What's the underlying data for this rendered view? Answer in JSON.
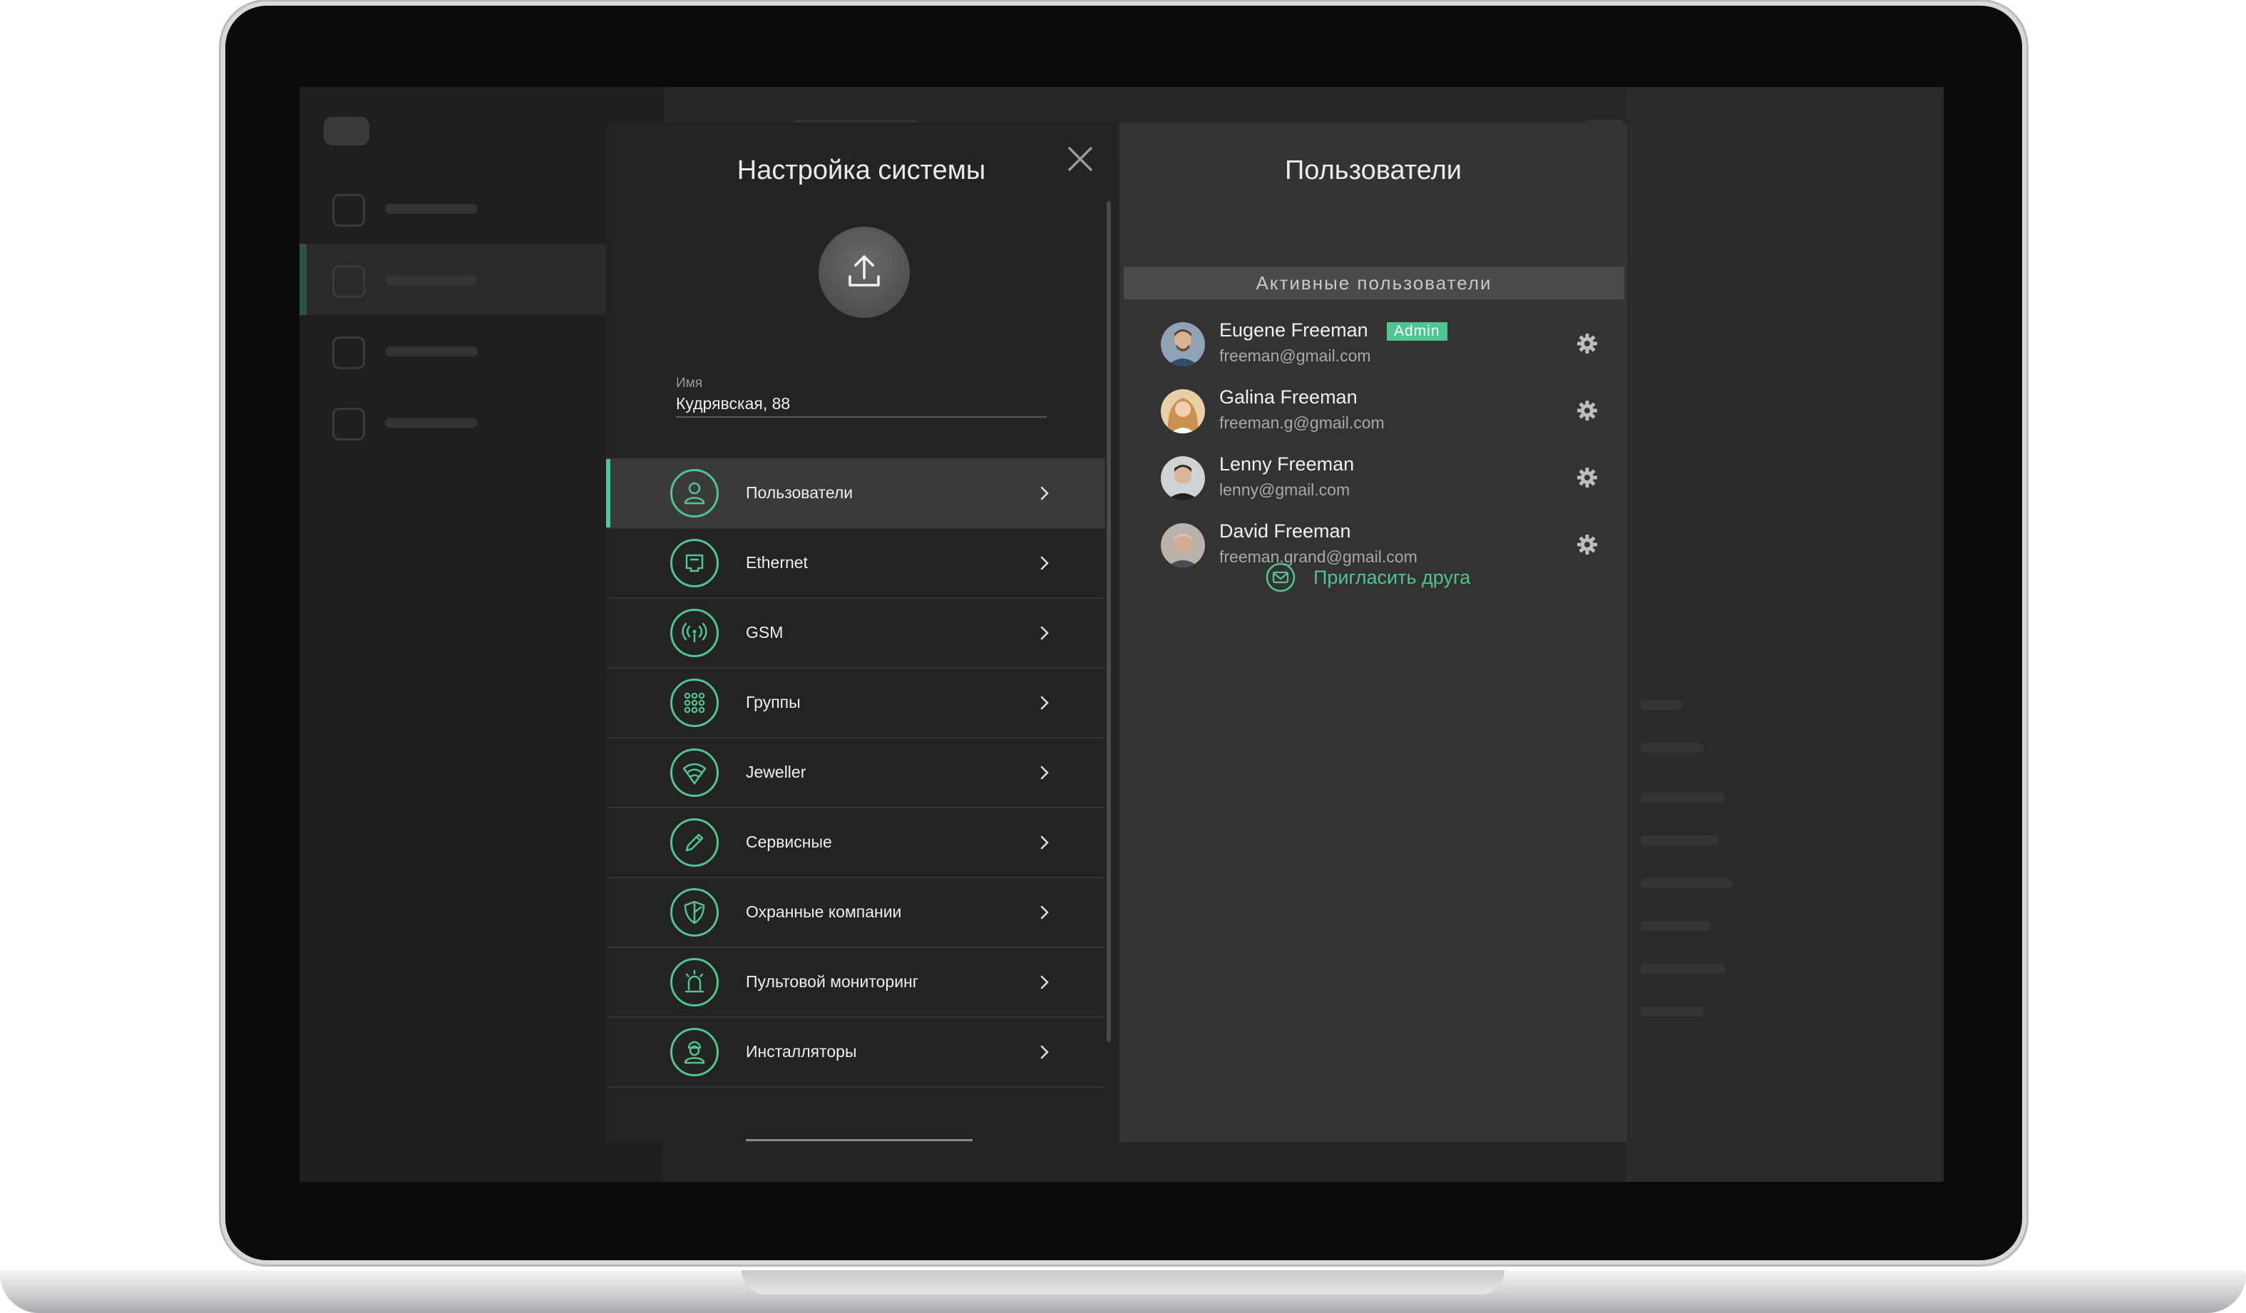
{
  "settings": {
    "title": "Настройка системы",
    "name_label": "Имя",
    "name_value": "Кудрявская, 88",
    "menu": [
      {
        "label": "Пользователи",
        "icon": "user-icon"
      },
      {
        "label": "Ethernet",
        "icon": "ethernet-icon"
      },
      {
        "label": "GSM",
        "icon": "antenna-icon"
      },
      {
        "label": "Группы",
        "icon": "grid-icon"
      },
      {
        "label": "Jeweller",
        "icon": "wifi-diamond-icon"
      },
      {
        "label": "Сервисные",
        "icon": "pencil-icon"
      },
      {
        "label": "Охранные компании",
        "icon": "shield-icon"
      },
      {
        "label": "Пультовой мониторинг",
        "icon": "siren-icon"
      },
      {
        "label": "Инсталляторы",
        "icon": "installer-icon"
      }
    ]
  },
  "users": {
    "title": "Пользователи",
    "section_header": "Активные пользователи",
    "admin_badge": "Admin",
    "list": [
      {
        "name": "Eugene Freeman",
        "email": "freeman@gmail.com"
      },
      {
        "name": "Galina Freeman",
        "email": "freeman.g@gmail.com"
      },
      {
        "name": "Lenny Freeman",
        "email": "lenny@gmail.com"
      },
      {
        "name": "David Freeman",
        "email": "freeman.grand@gmail.com"
      }
    ],
    "invite_label": "Пригласить друга"
  },
  "colors": {
    "accent": "#4fc58f",
    "panel_dark": "#232323",
    "panel_users": "#333333"
  }
}
